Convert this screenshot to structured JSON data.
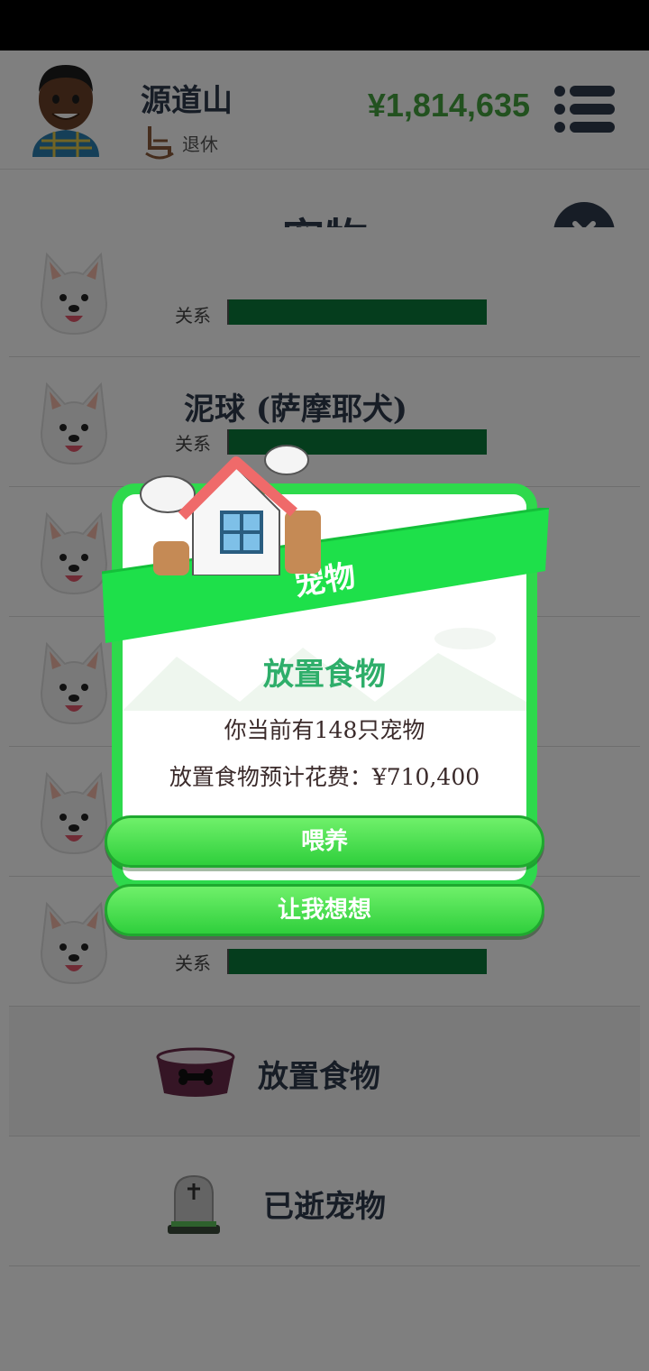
{
  "header": {
    "player_name": "源道山",
    "status": "退休",
    "money": "¥1,814,635"
  },
  "page": {
    "title": "宠物"
  },
  "pets": [
    {
      "name": "",
      "relation_label": "关系",
      "relation_level": 1.0
    },
    {
      "name": "泥球 (萨摩耶犬)",
      "relation_label": "关系",
      "relation_level": 1.0
    },
    {
      "name": "",
      "relation_label": "",
      "relation_level": 1.0
    },
    {
      "name": "",
      "relation_label": "",
      "relation_level": 1.0
    },
    {
      "name": "",
      "relation_label": "",
      "relation_level": 1.0
    },
    {
      "name": "",
      "relation_label": "关系",
      "relation_level": 1.0
    }
  ],
  "actions": {
    "feed_label": "放置食物",
    "deceased_label": "已逝宠物"
  },
  "dialog": {
    "banner_title": "宠物",
    "subtitle": "放置食物",
    "line1": "你当前有148只宠物",
    "line2": "放置食物预计花费：¥710,400",
    "confirm_label": "喂养",
    "cancel_label": "让我想想"
  },
  "colors": {
    "money": "#45a33f",
    "relation_bar": "#0a7a3a",
    "dialog_green": "#2ed94c",
    "subtitle_green": "#2eae6a"
  }
}
